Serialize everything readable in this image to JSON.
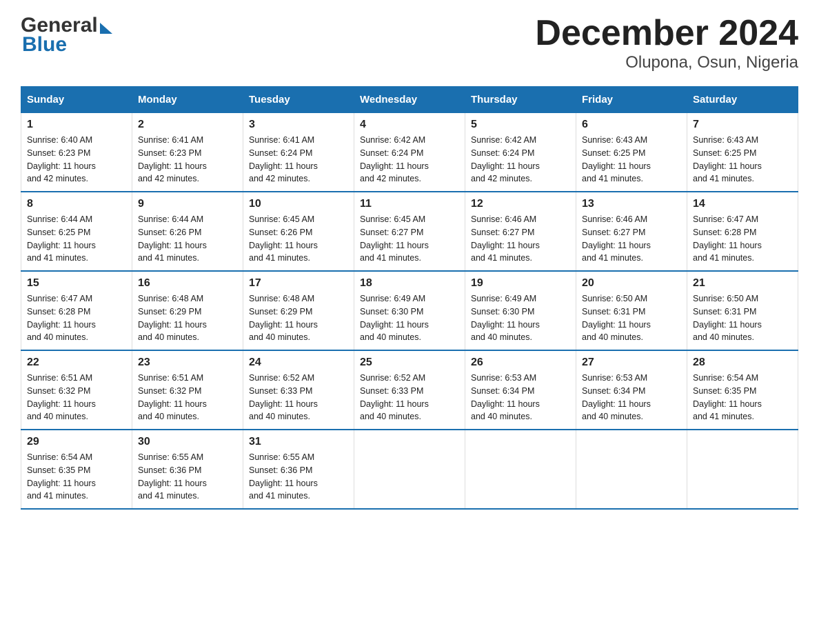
{
  "header": {
    "title": "December 2024",
    "subtitle": "Olupona, Osun, Nigeria",
    "logo_general": "General",
    "logo_blue": "Blue"
  },
  "calendar": {
    "days_of_week": [
      "Sunday",
      "Monday",
      "Tuesday",
      "Wednesday",
      "Thursday",
      "Friday",
      "Saturday"
    ],
    "weeks": [
      [
        {
          "day": "1",
          "sunrise": "6:40 AM",
          "sunset": "6:23 PM",
          "daylight": "11 hours and 42 minutes."
        },
        {
          "day": "2",
          "sunrise": "6:41 AM",
          "sunset": "6:23 PM",
          "daylight": "11 hours and 42 minutes."
        },
        {
          "day": "3",
          "sunrise": "6:41 AM",
          "sunset": "6:24 PM",
          "daylight": "11 hours and 42 minutes."
        },
        {
          "day": "4",
          "sunrise": "6:42 AM",
          "sunset": "6:24 PM",
          "daylight": "11 hours and 42 minutes."
        },
        {
          "day": "5",
          "sunrise": "6:42 AM",
          "sunset": "6:24 PM",
          "daylight": "11 hours and 42 minutes."
        },
        {
          "day": "6",
          "sunrise": "6:43 AM",
          "sunset": "6:25 PM",
          "daylight": "11 hours and 41 minutes."
        },
        {
          "day": "7",
          "sunrise": "6:43 AM",
          "sunset": "6:25 PM",
          "daylight": "11 hours and 41 minutes."
        }
      ],
      [
        {
          "day": "8",
          "sunrise": "6:44 AM",
          "sunset": "6:25 PM",
          "daylight": "11 hours and 41 minutes."
        },
        {
          "day": "9",
          "sunrise": "6:44 AM",
          "sunset": "6:26 PM",
          "daylight": "11 hours and 41 minutes."
        },
        {
          "day": "10",
          "sunrise": "6:45 AM",
          "sunset": "6:26 PM",
          "daylight": "11 hours and 41 minutes."
        },
        {
          "day": "11",
          "sunrise": "6:45 AM",
          "sunset": "6:27 PM",
          "daylight": "11 hours and 41 minutes."
        },
        {
          "day": "12",
          "sunrise": "6:46 AM",
          "sunset": "6:27 PM",
          "daylight": "11 hours and 41 minutes."
        },
        {
          "day": "13",
          "sunrise": "6:46 AM",
          "sunset": "6:27 PM",
          "daylight": "11 hours and 41 minutes."
        },
        {
          "day": "14",
          "sunrise": "6:47 AM",
          "sunset": "6:28 PM",
          "daylight": "11 hours and 41 minutes."
        }
      ],
      [
        {
          "day": "15",
          "sunrise": "6:47 AM",
          "sunset": "6:28 PM",
          "daylight": "11 hours and 40 minutes."
        },
        {
          "day": "16",
          "sunrise": "6:48 AM",
          "sunset": "6:29 PM",
          "daylight": "11 hours and 40 minutes."
        },
        {
          "day": "17",
          "sunrise": "6:48 AM",
          "sunset": "6:29 PM",
          "daylight": "11 hours and 40 minutes."
        },
        {
          "day": "18",
          "sunrise": "6:49 AM",
          "sunset": "6:30 PM",
          "daylight": "11 hours and 40 minutes."
        },
        {
          "day": "19",
          "sunrise": "6:49 AM",
          "sunset": "6:30 PM",
          "daylight": "11 hours and 40 minutes."
        },
        {
          "day": "20",
          "sunrise": "6:50 AM",
          "sunset": "6:31 PM",
          "daylight": "11 hours and 40 minutes."
        },
        {
          "day": "21",
          "sunrise": "6:50 AM",
          "sunset": "6:31 PM",
          "daylight": "11 hours and 40 minutes."
        }
      ],
      [
        {
          "day": "22",
          "sunrise": "6:51 AM",
          "sunset": "6:32 PM",
          "daylight": "11 hours and 40 minutes."
        },
        {
          "day": "23",
          "sunrise": "6:51 AM",
          "sunset": "6:32 PM",
          "daylight": "11 hours and 40 minutes."
        },
        {
          "day": "24",
          "sunrise": "6:52 AM",
          "sunset": "6:33 PM",
          "daylight": "11 hours and 40 minutes."
        },
        {
          "day": "25",
          "sunrise": "6:52 AM",
          "sunset": "6:33 PM",
          "daylight": "11 hours and 40 minutes."
        },
        {
          "day": "26",
          "sunrise": "6:53 AM",
          "sunset": "6:34 PM",
          "daylight": "11 hours and 40 minutes."
        },
        {
          "day": "27",
          "sunrise": "6:53 AM",
          "sunset": "6:34 PM",
          "daylight": "11 hours and 40 minutes."
        },
        {
          "day": "28",
          "sunrise": "6:54 AM",
          "sunset": "6:35 PM",
          "daylight": "11 hours and 41 minutes."
        }
      ],
      [
        {
          "day": "29",
          "sunrise": "6:54 AM",
          "sunset": "6:35 PM",
          "daylight": "11 hours and 41 minutes."
        },
        {
          "day": "30",
          "sunrise": "6:55 AM",
          "sunset": "6:36 PM",
          "daylight": "11 hours and 41 minutes."
        },
        {
          "day": "31",
          "sunrise": "6:55 AM",
          "sunset": "6:36 PM",
          "daylight": "11 hours and 41 minutes."
        },
        null,
        null,
        null,
        null
      ]
    ],
    "labels": {
      "sunrise": "Sunrise:",
      "sunset": "Sunset:",
      "daylight": "Daylight:"
    }
  }
}
